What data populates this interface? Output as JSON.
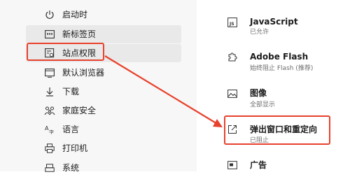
{
  "nav": {
    "items": [
      {
        "label": "启动时",
        "icon": "power-icon"
      },
      {
        "label": "新标签页",
        "icon": "new-tab-icon"
      },
      {
        "label": "站点权限",
        "icon": "site-permissions-icon"
      },
      {
        "label": "默认浏览器",
        "icon": "default-browser-icon"
      },
      {
        "label": "下载",
        "icon": "download-icon"
      },
      {
        "label": "家庭安全",
        "icon": "family-icon"
      },
      {
        "label": "语言",
        "icon": "language-icon"
      },
      {
        "label": "打印机",
        "icon": "printer-icon"
      },
      {
        "label": "系统",
        "icon": "system-icon"
      }
    ]
  },
  "permissions": {
    "items": [
      {
        "title": "JavaScript",
        "subtitle": "已允许",
        "icon": "javascript-icon"
      },
      {
        "title": "Adobe Flash",
        "subtitle": "始终阻止 Flash (推荐)",
        "icon": "puzzle-icon"
      },
      {
        "title": "图像",
        "subtitle": "全部显示",
        "icon": "image-icon"
      },
      {
        "title": "弹出窗口和重定向",
        "subtitle": "已阻止",
        "icon": "popup-icon"
      },
      {
        "title": "广告",
        "subtitle": "",
        "icon": "ads-icon"
      }
    ]
  },
  "colors": {
    "highlight": "#e8412c",
    "selected_bg": "#e9e9e9",
    "left_bg": "#f7f7f7"
  }
}
